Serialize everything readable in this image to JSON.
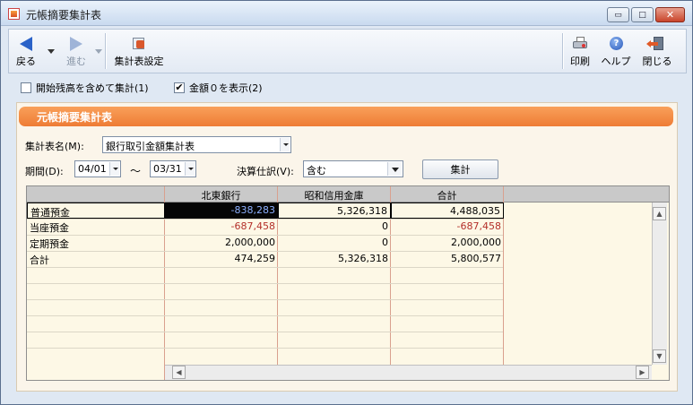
{
  "window": {
    "title": "元帳摘要集計表",
    "min_glyph": "▭",
    "max_glyph": "□",
    "close_glyph": "✕"
  },
  "toolbar": {
    "back_label": "戻る",
    "forward_label": "進む",
    "summary_settings_label": "集計表設定",
    "print_label": "印刷",
    "help_label": "ヘルプ",
    "close_label": "閉じる"
  },
  "options": {
    "include_opening_label": "開始残高を含めて集計(1)",
    "include_opening_checked": false,
    "show_zero_label": "金額０を表示(2)",
    "show_zero_checked": true
  },
  "panel": {
    "header": "元帳摘要集計表"
  },
  "form": {
    "table_name_label": "集計表名(M):",
    "table_name_value": "銀行取引金額集計表",
    "period_label": "期間(D):",
    "period_from": "04/01",
    "period_sep": "～",
    "period_to": "03/31",
    "closing_label": "決算仕訳(V):",
    "closing_value": "含む",
    "aggregate_button": "集計"
  },
  "grid": {
    "columns": [
      "北東銀行",
      "昭和信用金庫",
      "合計"
    ],
    "rows": [
      {
        "label": "普通預金",
        "values": [
          "-838,283",
          "5,326,318",
          "4,488,035"
        ]
      },
      {
        "label": "当座預金",
        "values": [
          "-687,458",
          "0",
          "-687,458"
        ]
      },
      {
        "label": "定期預金",
        "values": [
          "2,000,000",
          "0",
          "2,000,000"
        ]
      },
      {
        "label": "合計",
        "values": [
          "474,259",
          "5,326,318",
          "5,800,577"
        ]
      }
    ]
  },
  "icons": {
    "back": "arrow-left-icon",
    "forward": "arrow-right-icon",
    "settings": "summary-settings-icon",
    "print": "printer-icon",
    "help": "help-icon",
    "close": "exit-icon"
  },
  "colors": {
    "panel_header": "#ee7c35",
    "negative": "#b4302a",
    "selected_text": "#8db0ff"
  }
}
